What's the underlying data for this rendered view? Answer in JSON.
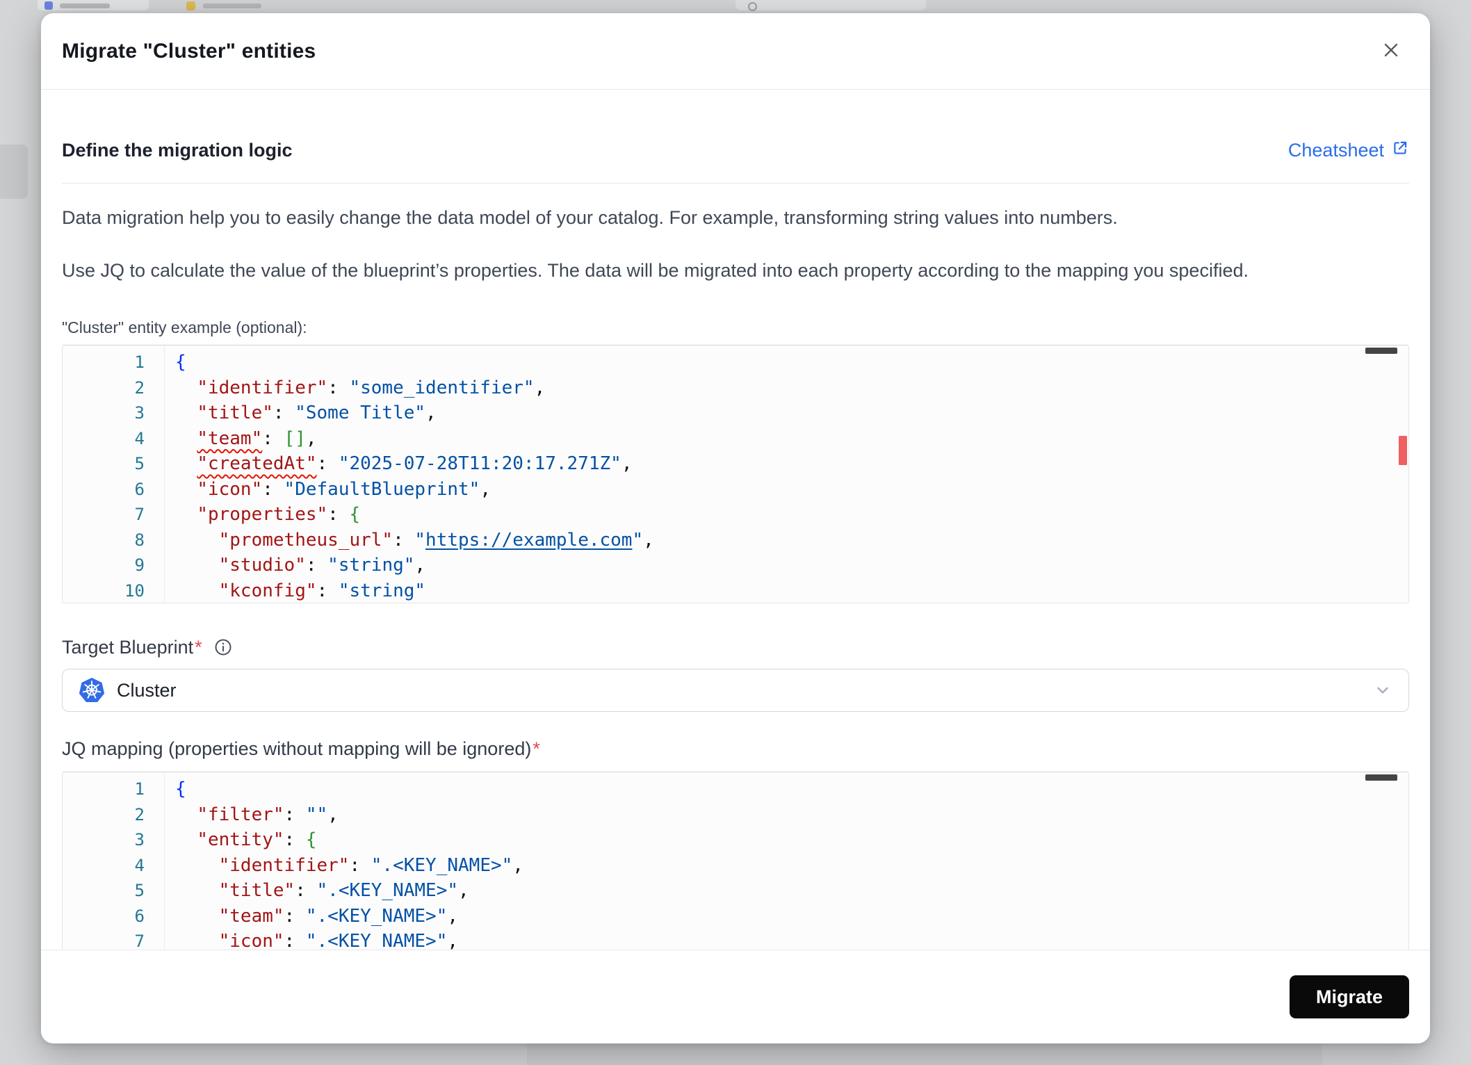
{
  "colors": {
    "accent": "#2b6de8",
    "danger": "#e5484d",
    "k8s-blue": "#326ce5",
    "button": "#0a0a0a",
    "code-key": "#a31515",
    "code-str": "#0451a5",
    "bracket-1": "#0431fa",
    "bracket-2": "#319331",
    "line-number": "#237893",
    "squiggle": "#e51400"
  },
  "modal": {
    "title": "Migrate \"Cluster\" entities"
  },
  "section": {
    "heading": "Define the migration logic",
    "cheatsheet": "Cheatsheet",
    "paragraph1": "Data migration help you to easily change the data model of your catalog. For example, transforming string values into numbers.",
    "paragraph2": "Use JQ to calculate the value of the blueprint’s properties. The data will be migrated into each property according to the mapping you specified."
  },
  "example_editor": {
    "label": "\"Cluster\" entity example (optional):",
    "lines": [
      [
        [
          "b1",
          "{"
        ]
      ],
      [
        [
          "pn",
          "  "
        ],
        [
          "key",
          "\"identifier\""
        ],
        [
          "pn",
          ": "
        ],
        [
          "str",
          "\"some_identifier\""
        ],
        [
          "pn",
          ","
        ]
      ],
      [
        [
          "pn",
          "  "
        ],
        [
          "key",
          "\"title\""
        ],
        [
          "pn",
          ": "
        ],
        [
          "str",
          "\"Some Title\""
        ],
        [
          "pn",
          ","
        ]
      ],
      [
        [
          "pn",
          "  "
        ],
        [
          "keyw",
          "\"team\""
        ],
        [
          "pn",
          ": "
        ],
        [
          "b2",
          "[]"
        ],
        [
          "pn",
          ","
        ]
      ],
      [
        [
          "pn",
          "  "
        ],
        [
          "keyw",
          "\"createdAt\""
        ],
        [
          "pn",
          ": "
        ],
        [
          "str",
          "\"2025-07-28T11:20:17.271Z\""
        ],
        [
          "pn",
          ","
        ]
      ],
      [
        [
          "pn",
          "  "
        ],
        [
          "key",
          "\"icon\""
        ],
        [
          "pn",
          ": "
        ],
        [
          "str",
          "\"DefaultBlueprint\""
        ],
        [
          "pn",
          ","
        ]
      ],
      [
        [
          "pn",
          "  "
        ],
        [
          "key",
          "\"properties\""
        ],
        [
          "pn",
          ": "
        ],
        [
          "b2",
          "{"
        ]
      ],
      [
        [
          "pn",
          "    "
        ],
        [
          "key",
          "\"prometheus_url\""
        ],
        [
          "pn",
          ": "
        ],
        [
          "str",
          "\""
        ],
        [
          "link",
          "https://example.com"
        ],
        [
          "str",
          "\""
        ],
        [
          "pn",
          ","
        ]
      ],
      [
        [
          "pn",
          "    "
        ],
        [
          "key",
          "\"studio\""
        ],
        [
          "pn",
          ": "
        ],
        [
          "str",
          "\"string\""
        ],
        [
          "pn",
          ","
        ]
      ],
      [
        [
          "pn",
          "    "
        ],
        [
          "key",
          "\"kconfig\""
        ],
        [
          "pn",
          ": "
        ],
        [
          "str",
          "\"string\""
        ]
      ]
    ]
  },
  "target_blueprint": {
    "label": "Target Blueprint",
    "required": "*",
    "value": "Cluster"
  },
  "jq_editor": {
    "label": "JQ mapping (properties without mapping will be ignored)",
    "required": "*",
    "lines": [
      [
        [
          "b1",
          "{"
        ]
      ],
      [
        [
          "pn",
          "  "
        ],
        [
          "key",
          "\"filter\""
        ],
        [
          "pn",
          ": "
        ],
        [
          "str",
          "\"\""
        ],
        [
          "pn",
          ","
        ]
      ],
      [
        [
          "pn",
          "  "
        ],
        [
          "key",
          "\"entity\""
        ],
        [
          "pn",
          ": "
        ],
        [
          "b2",
          "{"
        ]
      ],
      [
        [
          "pn",
          "    "
        ],
        [
          "key",
          "\"identifier\""
        ],
        [
          "pn",
          ": "
        ],
        [
          "str",
          "\".<KEY_NAME>\""
        ],
        [
          "pn",
          ","
        ]
      ],
      [
        [
          "pn",
          "    "
        ],
        [
          "key",
          "\"title\""
        ],
        [
          "pn",
          ": "
        ],
        [
          "str",
          "\".<KEY_NAME>\""
        ],
        [
          "pn",
          ","
        ]
      ],
      [
        [
          "pn",
          "    "
        ],
        [
          "key",
          "\"team\""
        ],
        [
          "pn",
          ": "
        ],
        [
          "str",
          "\".<KEY_NAME>\""
        ],
        [
          "pn",
          ","
        ]
      ],
      [
        [
          "pn",
          "    "
        ],
        [
          "key",
          "\"icon\""
        ],
        [
          "pn",
          ": "
        ],
        [
          "str",
          "\".<KEY_NAME>\""
        ],
        [
          "pn",
          ","
        ]
      ]
    ]
  },
  "footer": {
    "migrate": "Migrate"
  }
}
